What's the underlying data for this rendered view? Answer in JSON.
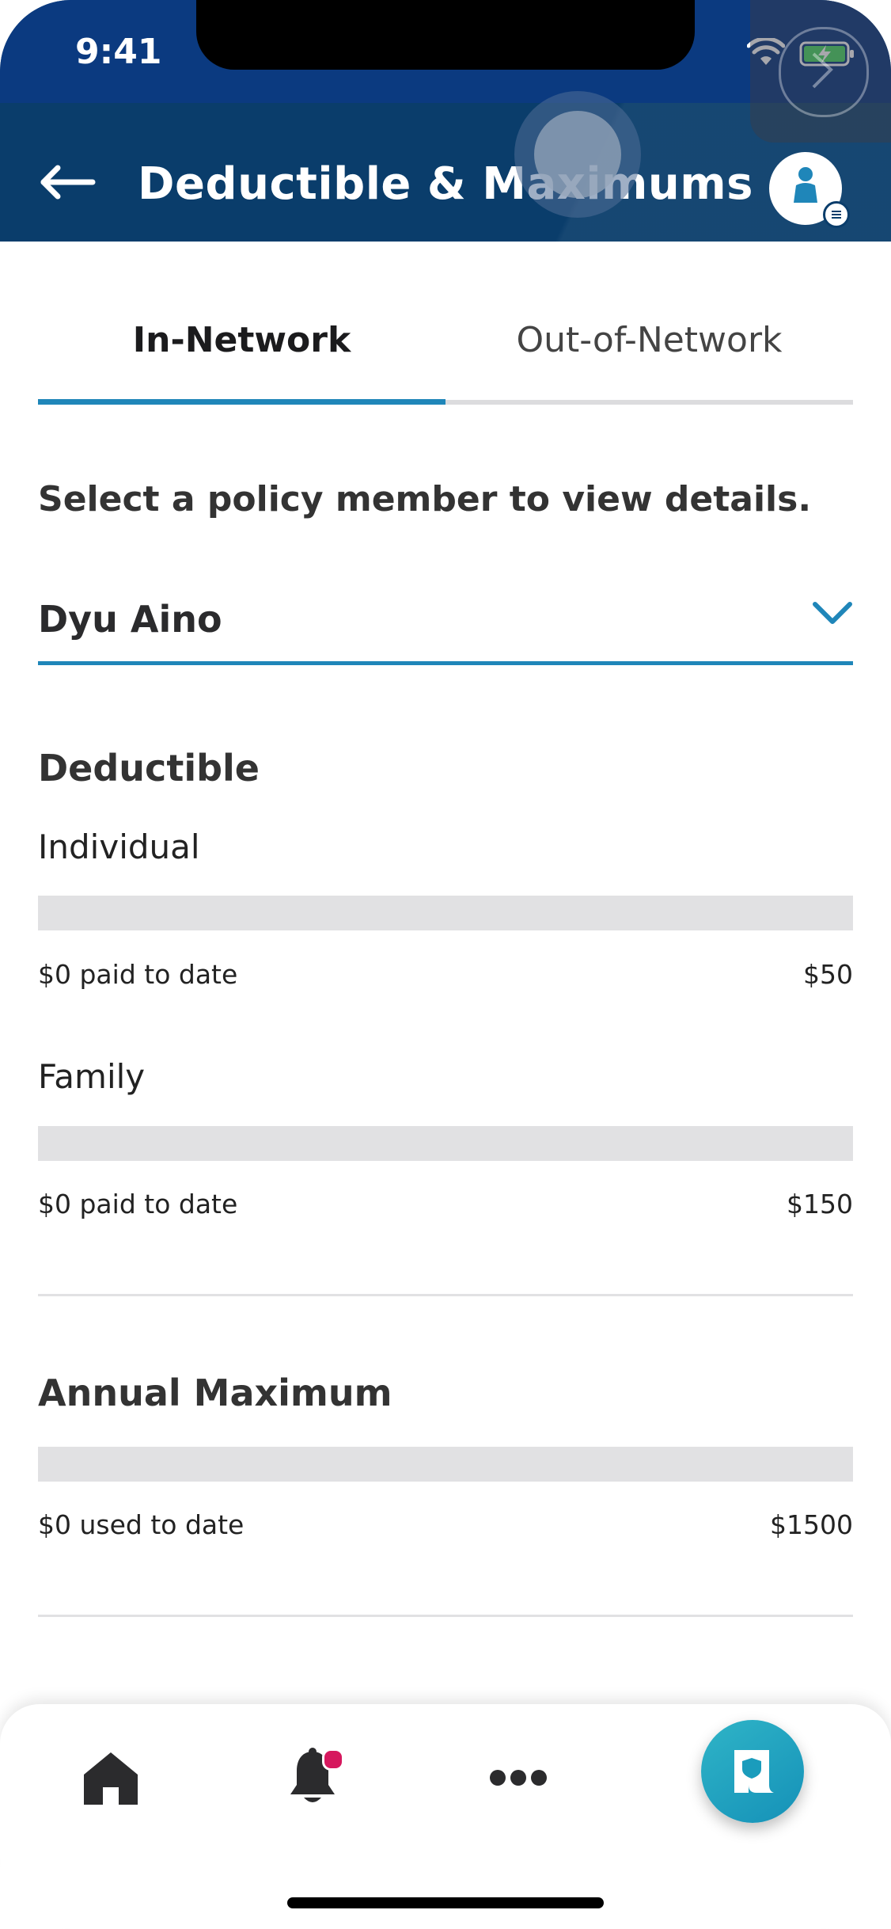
{
  "status_bar": {
    "time": "9:41"
  },
  "header": {
    "title": "Deductible & Maximums"
  },
  "tabs": [
    {
      "label": "In-Network",
      "active": true
    },
    {
      "label": "Out-of-Network",
      "active": false
    }
  ],
  "prompt": "Select a policy member to view details.",
  "member_select": {
    "value": "Dyu Aino"
  },
  "deductible": {
    "title": "Deductible",
    "individual": {
      "label": "Individual",
      "paid_text": "$0 paid to date",
      "max_text": "$50",
      "progress": 0
    },
    "family": {
      "label": "Family",
      "paid_text": "$0 paid to date",
      "max_text": "$150",
      "progress": 0
    }
  },
  "annual_maximum": {
    "title": "Annual Maximum",
    "used_text": "$0 used to date",
    "max_text": "$1500",
    "progress": 0
  },
  "colors": {
    "header": "#0a3d6b",
    "accent": "#1f86b9",
    "badge": "#d6185e",
    "bar_track": "#e1e1e3"
  },
  "bottom_nav": {
    "items": [
      {
        "icon": "home-icon"
      },
      {
        "icon": "bell-icon",
        "has_badge": true
      },
      {
        "icon": "more-icon"
      },
      {
        "icon": "id-card-icon"
      }
    ]
  }
}
